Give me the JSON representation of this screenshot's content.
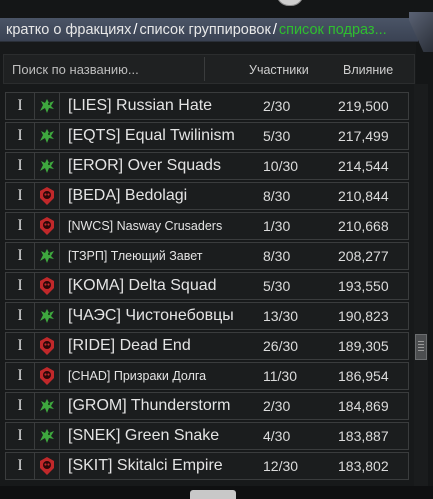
{
  "breadcrumb": {
    "item1": "кратко о фракциях",
    "sep1": "/",
    "item2": "список группировок",
    "sep2": "/",
    "item3": "список подраз..."
  },
  "header": {
    "search_placeholder": "Поиск по названию...",
    "col_members": "Участники",
    "col_influence": "Влияние"
  },
  "colors": {
    "bandit_emblem": "#3ea83e",
    "military_emblem": "#c0282a",
    "active_crumb": "#2fbf2f"
  },
  "rows": [
    {
      "rank": "I",
      "emblem": "green-dragon-icon",
      "name": "[LIES] Russian Hate",
      "members": "2/30",
      "influence": "219,500",
      "small": false
    },
    {
      "rank": "I",
      "emblem": "green-dragon-icon",
      "name": "[EQTS] Equal Twilinism",
      "members": "5/30",
      "influence": "217,499",
      "small": false
    },
    {
      "rank": "I",
      "emblem": "green-dragon-icon",
      "name": "[EROR] Over Squads",
      "members": "10/30",
      "influence": "214,544",
      "small": false
    },
    {
      "rank": "I",
      "emblem": "red-skull-icon",
      "name": "[BEDA] Bedolagi",
      "members": "8/30",
      "influence": "210,844",
      "small": false
    },
    {
      "rank": "I",
      "emblem": "red-skull-icon",
      "name": "[NWCS] Nasway Crusaders",
      "members": "1/30",
      "influence": "210,668",
      "small": true
    },
    {
      "rank": "I",
      "emblem": "green-dragon-icon",
      "name": "[ТЗРП] Тлеющий Завет",
      "members": "8/30",
      "influence": "208,277",
      "small": true
    },
    {
      "rank": "I",
      "emblem": "red-skull-icon",
      "name": "[KOMA] Delta Squad",
      "members": "5/30",
      "influence": "193,550",
      "small": false
    },
    {
      "rank": "I",
      "emblem": "green-dragon-icon",
      "name": "[ЧАЭС] Чистонебовцы",
      "members": "13/30",
      "influence": "190,823",
      "small": false
    },
    {
      "rank": "I",
      "emblem": "red-skull-icon",
      "name": "[RIDE] Dead End",
      "members": "26/30",
      "influence": "189,305",
      "small": false
    },
    {
      "rank": "I",
      "emblem": "red-skull-icon",
      "name": "[CHAD] Призраки Долга",
      "members": "11/30",
      "influence": "186,954",
      "small": true
    },
    {
      "rank": "I",
      "emblem": "green-dragon-icon",
      "name": "[GROM] Thunderstorm",
      "members": "2/30",
      "influence": "184,869",
      "small": false
    },
    {
      "rank": "I",
      "emblem": "green-dragon-icon",
      "name": "[SNEK] Green Snake",
      "members": "4/30",
      "influence": "183,887",
      "small": false
    },
    {
      "rank": "I",
      "emblem": "red-skull-icon",
      "name": "[SKIT] Skitalci Empire",
      "members": "12/30",
      "influence": "183,802",
      "small": false
    }
  ]
}
